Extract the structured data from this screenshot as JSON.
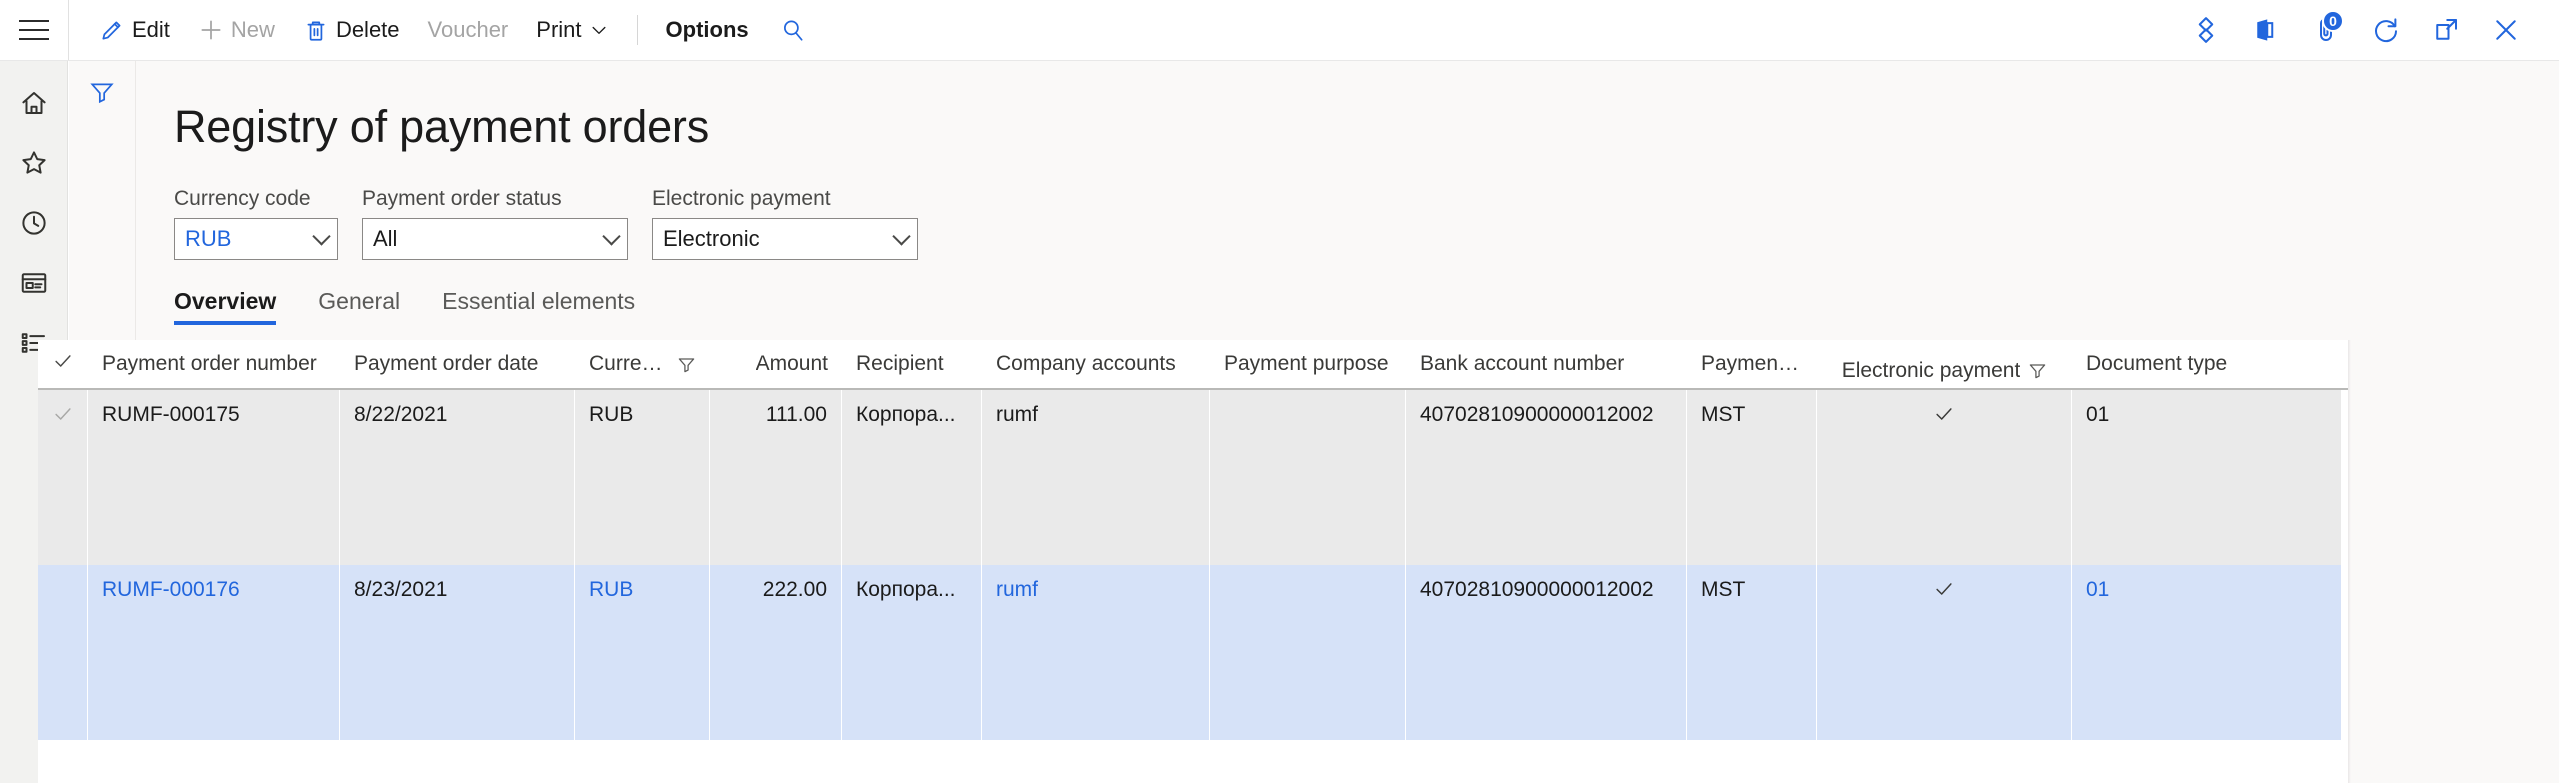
{
  "commandbar": {
    "menu_icon": "hamburger-icon",
    "items": [
      {
        "label": "Edit",
        "icon": "pencil-icon",
        "disabled": false,
        "bold": false
      },
      {
        "label": "New",
        "icon": "plus-icon",
        "disabled": true,
        "bold": false
      },
      {
        "label": "Delete",
        "icon": "trash-icon",
        "disabled": false,
        "bold": false
      },
      {
        "label": "Voucher",
        "icon": "",
        "disabled": true,
        "bold": false
      },
      {
        "label": "Print",
        "icon": "chevron-down-icon",
        "disabled": false,
        "bold": false
      },
      {
        "label": "Options",
        "icon": "",
        "disabled": false,
        "bold": true
      }
    ],
    "search_icon": "search-icon",
    "right_icons": [
      {
        "name": "dynamics-logo-icon",
        "badge": ""
      },
      {
        "name": "office-apps-icon",
        "badge": ""
      },
      {
        "name": "attachment-icon",
        "badge": "0"
      },
      {
        "name": "refresh-icon",
        "badge": ""
      },
      {
        "name": "open-in-new-icon",
        "badge": ""
      },
      {
        "name": "close-icon",
        "badge": ""
      }
    ]
  },
  "navrail": {
    "items": [
      {
        "name": "home-icon",
        "label": "Home"
      },
      {
        "name": "favorites-icon",
        "label": "Favorites"
      },
      {
        "name": "recent-icon",
        "label": "Recent"
      },
      {
        "name": "workspaces-icon",
        "label": "Workspaces"
      },
      {
        "name": "modules-icon",
        "label": "Modules"
      }
    ]
  },
  "gutter": {
    "filter_icon": "filter-pane-icon"
  },
  "page": {
    "title": "Registry of payment orders"
  },
  "filters": [
    {
      "label": "Currency code",
      "value": "RUB",
      "style": "link",
      "width": "w1"
    },
    {
      "label": "Payment order status",
      "value": "All",
      "style": "plain",
      "width": "w2"
    },
    {
      "label": "Electronic payment",
      "value": "Electronic",
      "style": "plain",
      "width": "w3"
    }
  ],
  "tabs": [
    {
      "label": "Overview",
      "active": true
    },
    {
      "label": "General",
      "active": false
    },
    {
      "label": "Essential elements",
      "active": false
    }
  ],
  "grid": {
    "select_all_icon": "checkmark-icon",
    "columns": [
      {
        "key": "chk",
        "label": "",
        "class": "c-chk",
        "filter": false,
        "align": "left"
      },
      {
        "key": "num",
        "label": "Payment order number",
        "class": "c-num",
        "filter": false,
        "align": "left"
      },
      {
        "key": "date",
        "label": "Payment order date",
        "class": "c-date",
        "filter": false,
        "align": "left"
      },
      {
        "key": "cur",
        "label": "Currency",
        "class": "c-cur",
        "filter": true,
        "align": "left"
      },
      {
        "key": "amt",
        "label": "Amount",
        "class": "c-amt",
        "filter": false,
        "align": "right"
      },
      {
        "key": "rec",
        "label": "Recipient",
        "class": "c-rec",
        "filter": false,
        "align": "left"
      },
      {
        "key": "comp",
        "label": "Company accounts",
        "class": "c-comp",
        "filter": false,
        "align": "left"
      },
      {
        "key": "purp",
        "label": "Payment purpose",
        "class": "c-purp",
        "filter": false,
        "align": "left"
      },
      {
        "key": "bank",
        "label": "Bank account number",
        "class": "c-bank",
        "filter": false,
        "align": "left"
      },
      {
        "key": "type",
        "label": "Payment order type",
        "class": "c-type",
        "filter": false,
        "align": "left"
      },
      {
        "key": "elec",
        "label": "Electronic payment",
        "class": "c-elec",
        "filter": true,
        "align": "center"
      },
      {
        "key": "doc",
        "label": "Document type",
        "class": "c-doc",
        "filter": false,
        "align": "left"
      }
    ],
    "rows": [
      {
        "state": "hover",
        "checked": true,
        "num": "RUMF-000175",
        "date": "8/22/2021",
        "cur": "RUB",
        "amt": "111.00",
        "rec": "Корпора...",
        "comp": "rumf",
        "purp": "",
        "bank": "40702810900000012002",
        "type": "MST",
        "elec": "checkmark-icon",
        "doc": "01",
        "links": []
      },
      {
        "state": "selected",
        "checked": false,
        "num": "RUMF-000176",
        "date": "8/23/2021",
        "cur": "RUB",
        "amt": "222.00",
        "rec": "Корпора...",
        "comp": "rumf",
        "purp": "",
        "bank": "40702810900000012002",
        "type": "MST",
        "elec": "checkmark-icon",
        "doc": "01",
        "links": [
          "num",
          "cur",
          "comp",
          "doc"
        ]
      }
    ]
  },
  "colors": {
    "accent": "#2266dd",
    "selected_row": "#d6e2f8",
    "hover_row": "#eaeaea",
    "page_bg": "#faf9f8"
  }
}
